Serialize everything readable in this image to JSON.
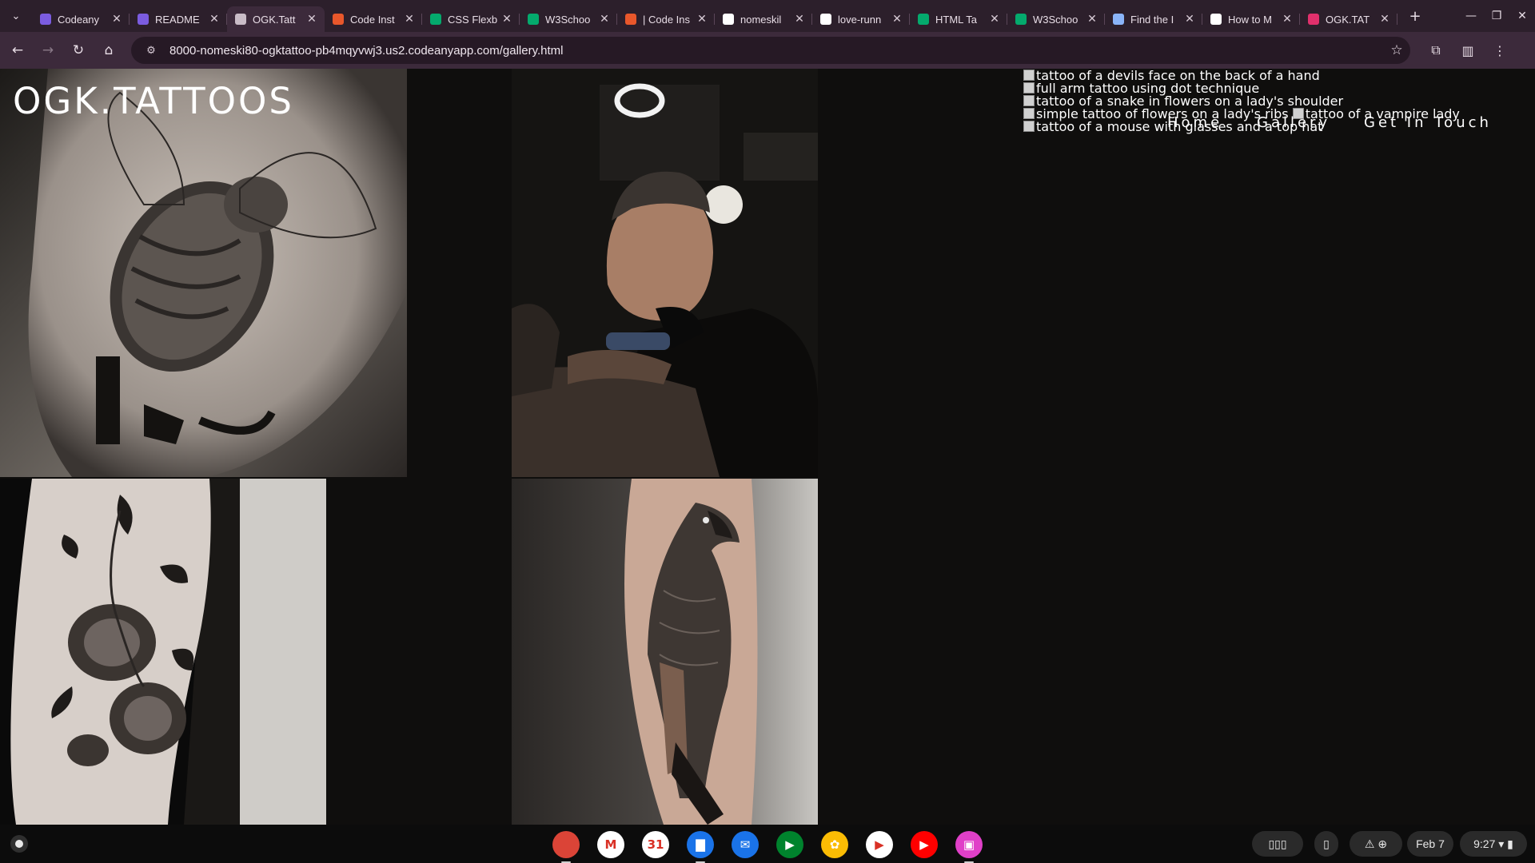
{
  "browser": {
    "tabs": [
      {
        "label": "Codeany",
        "icon": "codeanywhere-icon",
        "color": "#7b5ce0"
      },
      {
        "label": "README",
        "icon": "codeanywhere-icon",
        "color": "#7b5ce0"
      },
      {
        "label": "OGK.Tatt",
        "icon": "globe-icon",
        "color": "#c9bcc7",
        "active": true
      },
      {
        "label": "Code Inst",
        "icon": "code-institute-icon",
        "color": "#e8572b"
      },
      {
        "label": "CSS Flexb",
        "icon": "w3schools-icon",
        "color": "#04aa6d"
      },
      {
        "label": "W3Schoo",
        "icon": "w3schools-icon",
        "color": "#04aa6d"
      },
      {
        "label": "| Code Ins",
        "icon": "code-institute-icon",
        "color": "#e8572b"
      },
      {
        "label": "nomeskil",
        "icon": "github-icon",
        "color": "#ffffff"
      },
      {
        "label": "love-runn",
        "icon": "github-icon",
        "color": "#ffffff"
      },
      {
        "label": "HTML Ta",
        "icon": "w3schools-icon",
        "color": "#04aa6d"
      },
      {
        "label": "W3Schoo",
        "icon": "w3schools-icon",
        "color": "#04aa6d"
      },
      {
        "label": "Find the I",
        "icon": "flag-icon",
        "color": "#8ab4f8"
      },
      {
        "label": "How to M",
        "icon": "wikihow-icon",
        "color": "#ffffff"
      },
      {
        "label": "OGK.TAT",
        "icon": "instagram-icon",
        "color": "#e1306c"
      }
    ],
    "url": "8000-nomeski80-ogktattoo-pb4mqyvwj3.us2.codeanyapp.com/gallery.html"
  },
  "site": {
    "brand": "OGK.TATTOOS",
    "broken_images": [
      "tattoo of a devils face on the back of a hand",
      "full arm tattoo using dot technique",
      "tattoo of a snake in flowers on a lady's shoulder",
      "simple tattoo of flowers on a lady's ribs",
      "tattoo of a vampire lady",
      "tattoo of a mouse with glasses and a top hat"
    ],
    "nav": {
      "home": "Home",
      "gallery": "Gallery",
      "contact": "Get In Touch"
    },
    "photos": [
      "bee-tattoo-photo",
      "tattoo-artist-photo",
      "flower-tattoo-photo",
      "bird-tattoo-photo"
    ]
  },
  "shelf": {
    "apps": [
      {
        "name": "chrome-icon",
        "color": "#db4437",
        "glyph": "",
        "open": true
      },
      {
        "name": "gmail-icon",
        "color": "#ffffff",
        "glyph": "M"
      },
      {
        "name": "calendar-icon",
        "color": "#ffffff",
        "glyph": "31"
      },
      {
        "name": "files-icon",
        "color": "#1a73e8",
        "glyph": "▇",
        "open": true
      },
      {
        "name": "messages-icon",
        "color": "#1a73e8",
        "glyph": "✉"
      },
      {
        "name": "meet-icon",
        "color": "#00832d",
        "glyph": "▶"
      },
      {
        "name": "photos-icon",
        "color": "#fbbc04",
        "glyph": "✿"
      },
      {
        "name": "play-store-icon",
        "color": "#ffffff",
        "glyph": "▶"
      },
      {
        "name": "youtube-icon",
        "color": "#ff0000",
        "glyph": "▶"
      },
      {
        "name": "gallery-app-icon",
        "color": "#e040c8",
        "glyph": "▣",
        "open": true
      }
    ],
    "date": "Feb 7",
    "time": "9:27"
  }
}
